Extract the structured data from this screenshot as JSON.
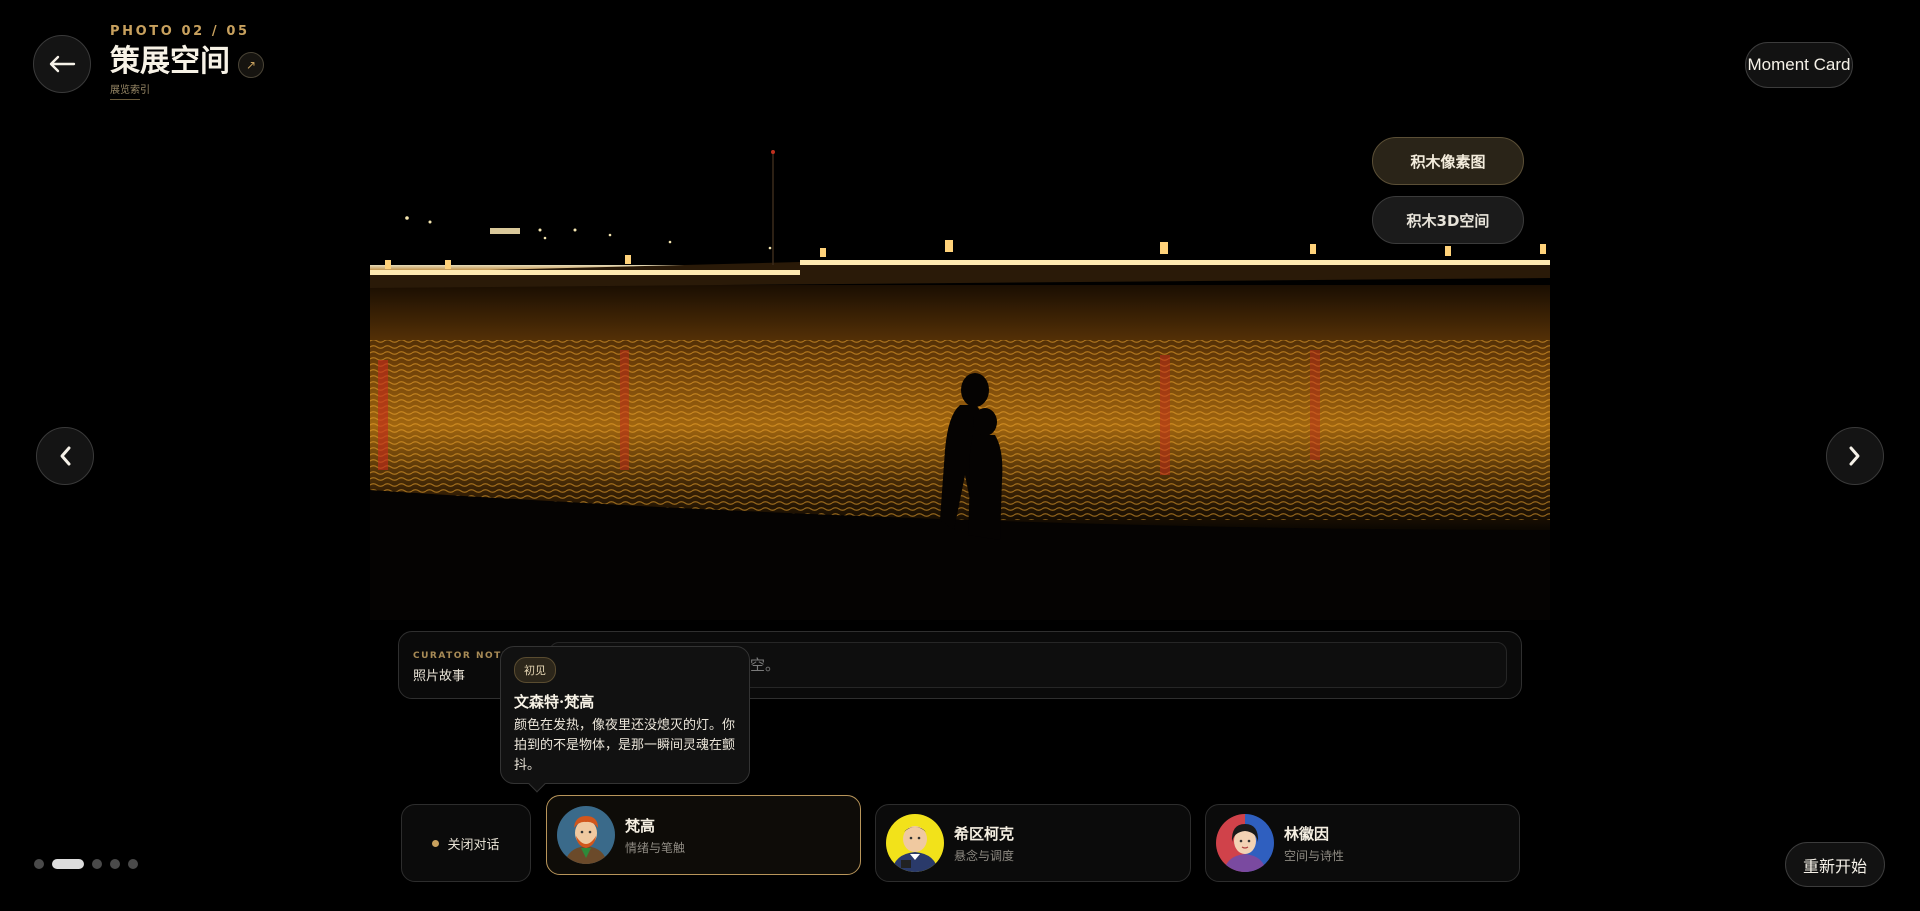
{
  "header": {
    "photo_counter": "PHOTO 02 / 05",
    "title": "策展空间",
    "subtitle": "展览索引",
    "link_icon": "↗"
  },
  "top_right": {
    "moment_card_label": "Moment Card"
  },
  "nav": {
    "back_icon": "arrow-left-icon",
    "prev_icon": "chevron-left-icon",
    "next_icon": "chevron-right-icon"
  },
  "photo_actions": {
    "pixel_label": "积木像素图",
    "space3d_label": "积木3D空间"
  },
  "curator_note": {
    "eyebrow": "CURATOR NOTE",
    "label": "照片故事",
    "placeholder": "写下这张照片的故事，可留空。"
  },
  "bubble": {
    "tag": "初见",
    "name": "文森特·梵高",
    "text": "颜色在发热，像夜里还没熄灭的灯。你拍到的不是物体，是那一瞬间灵魂在颤抖。"
  },
  "close_chat_label": "关闭对话",
  "personas": [
    {
      "name": "梵高",
      "desc": "情绪与笔触",
      "active": true
    },
    {
      "name": "希区柯克",
      "desc": "悬念与调度",
      "active": false
    },
    {
      "name": "林徽因",
      "desc": "空间与诗性",
      "active": false
    }
  ],
  "pagination": {
    "total": 5,
    "active_index": 1
  },
  "restart_label": "重新开始",
  "colors": {
    "accent": "#c8a15e",
    "background": "#000000",
    "panel": "#0b0b0b"
  }
}
